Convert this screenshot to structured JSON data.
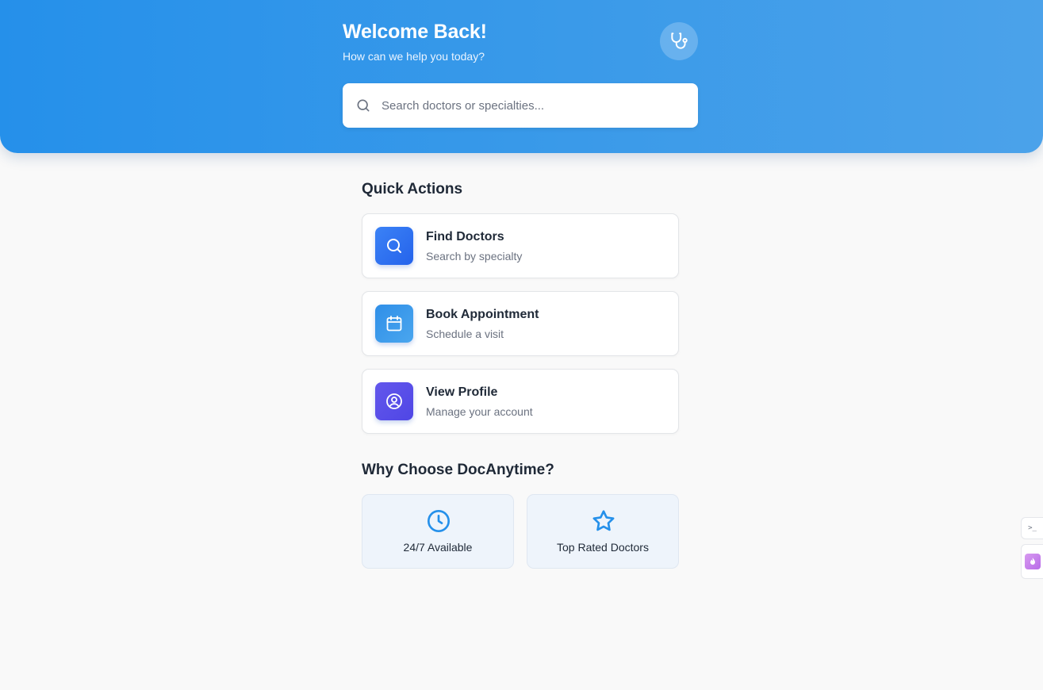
{
  "header": {
    "title": "Welcome Back!",
    "subtitle": "How can we help you today?",
    "badge_icon": "stethoscope-icon"
  },
  "search": {
    "placeholder": "Search doctors or specialties...",
    "value": "",
    "icon": "search-icon"
  },
  "quick_actions": {
    "title": "Quick Actions",
    "items": [
      {
        "title": "Find Doctors",
        "subtitle": "Search by specialty",
        "icon": "search-icon",
        "color": "#2f6fe6"
      },
      {
        "title": "Book Appointment",
        "subtitle": "Schedule a visit",
        "icon": "calendar-icon",
        "color": "#3297ea"
      },
      {
        "title": "View Profile",
        "subtitle": "Manage your account",
        "icon": "user-circle-icon",
        "color": "#5548e6"
      }
    ]
  },
  "why": {
    "title": "Why Choose DocAnytime?",
    "features": [
      {
        "label": "24/7 Available",
        "icon": "clock-icon"
      },
      {
        "label": "Top Rated Doctors",
        "icon": "star-icon"
      }
    ]
  },
  "colors": {
    "header_start": "#2590ea",
    "header_end": "#4ba2ea",
    "accent": "#2590ea",
    "background": "#f9f9f9",
    "feature_bg": "#eef4fb"
  }
}
